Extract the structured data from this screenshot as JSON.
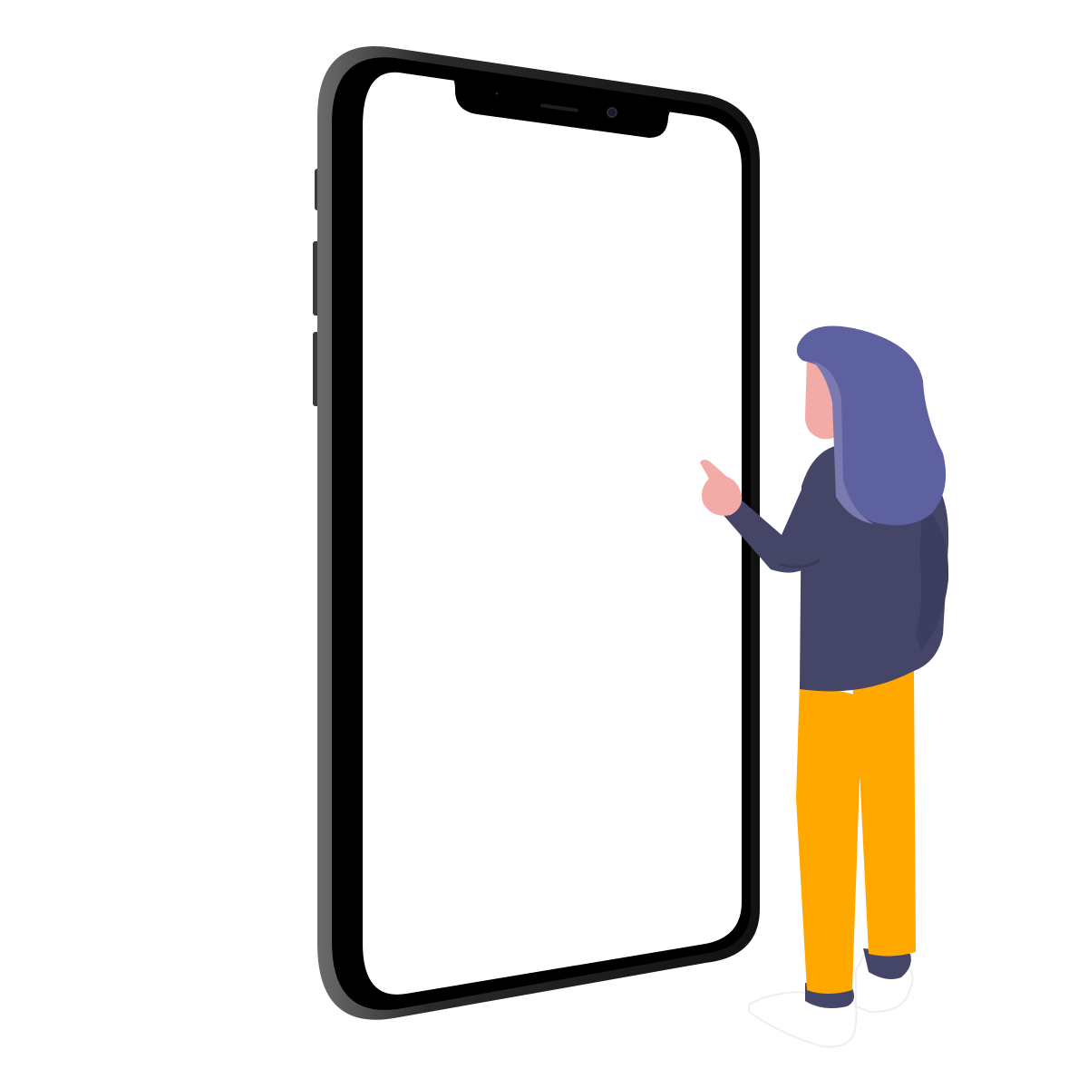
{
  "scene": {
    "background_color": "#ffffff",
    "phone": {
      "frame_color": "#1c1c1c",
      "frame_edge_color": "#4a4a4a",
      "bezel_color": "#000000",
      "screen_color": "#ffffff",
      "screen_content": ""
    },
    "person": {
      "hair_color": "#5d619f",
      "skin_color": "#f2aba6",
      "sweater_color": "#454568",
      "pants_color": "#ffa800",
      "shoe_color": "#ffffff",
      "sock_color": "#454568"
    }
  }
}
